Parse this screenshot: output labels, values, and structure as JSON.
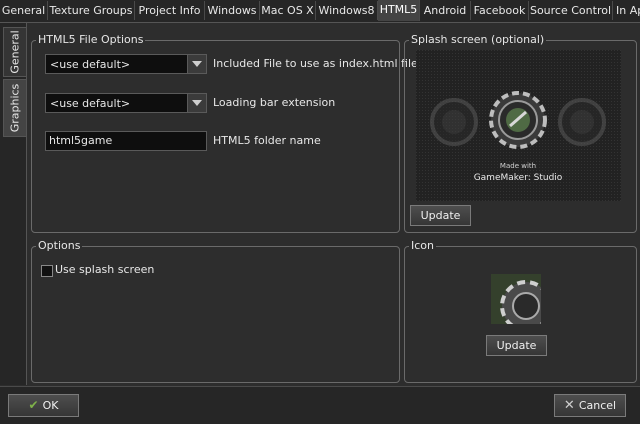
{
  "tabs": [
    {
      "label": "General",
      "active": false
    },
    {
      "label": "Texture Groups",
      "active": false
    },
    {
      "label": "Project Info",
      "active": false
    },
    {
      "label": "Windows",
      "active": false
    },
    {
      "label": "Mac OS X",
      "active": false
    },
    {
      "label": "Windows8",
      "active": false
    },
    {
      "label": "HTML5",
      "active": true
    },
    {
      "label": "Android",
      "active": false
    },
    {
      "label": "Facebook",
      "active": false
    },
    {
      "label": "Source Control",
      "active": false
    },
    {
      "label": "In Ap",
      "active": false
    }
  ],
  "side_tabs": [
    {
      "label": "General",
      "active": false
    },
    {
      "label": "Graphics",
      "active": true
    }
  ],
  "html5_options": {
    "title": "HTML5 File Options",
    "index_select_value": "<use default>",
    "index_label": "Included File to use as index.html file",
    "loading_select_value": "<use default>",
    "loading_label": "Loading bar extension",
    "folder_value": "html5game",
    "folder_label": "HTML5 folder name"
  },
  "splash": {
    "title": "Splash screen (optional)",
    "made_with": "Made with",
    "brand": "GameMaker: Studio",
    "update_label": "Update"
  },
  "options": {
    "title": "Options",
    "use_splash_label": "Use splash screen",
    "use_splash_checked": false
  },
  "icon_panel": {
    "title": "Icon",
    "update_label": "Update"
  },
  "footer": {
    "ok_label": "OK",
    "cancel_label": "Cancel"
  },
  "colors": {
    "ok_icon": "#7fb24a",
    "cancel_icon": "#cfcfcf"
  }
}
